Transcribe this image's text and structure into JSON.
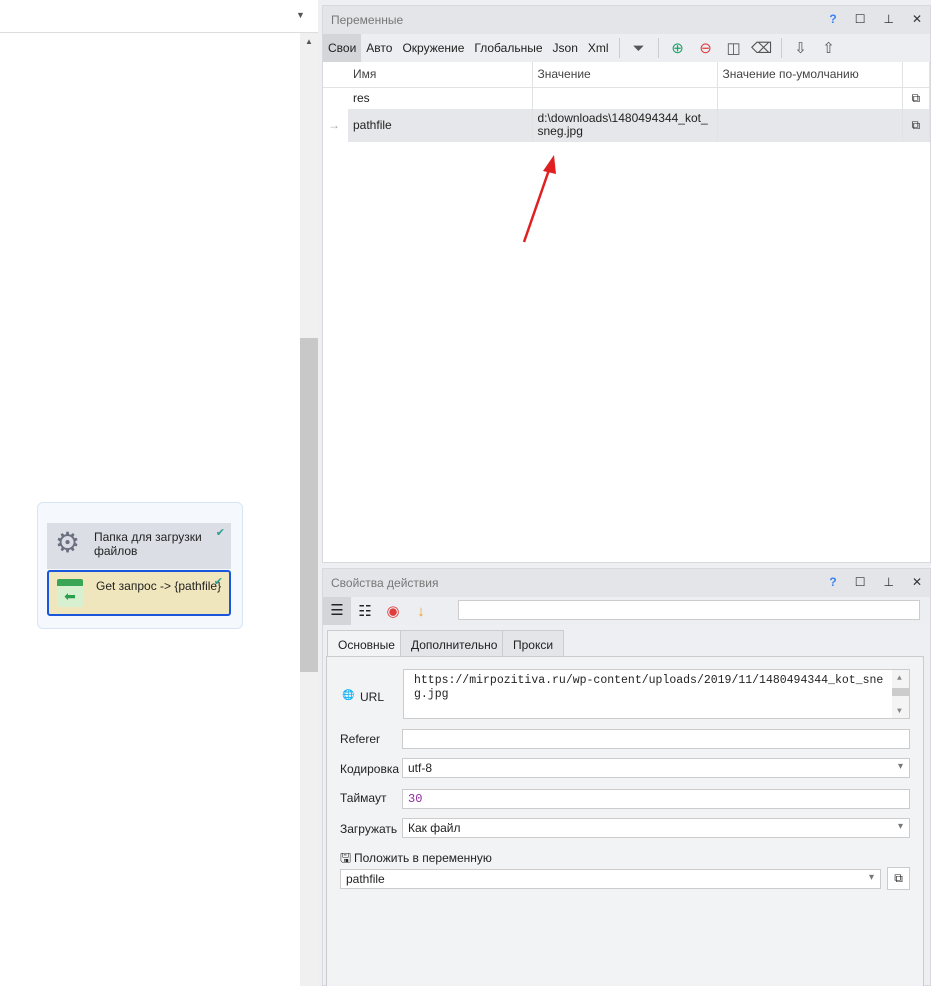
{
  "canvas": {
    "nodes": [
      {
        "label": "Папка для загрузки файлов",
        "icon": "gear-icon"
      },
      {
        "label": "Get запрос -> {pathfile}",
        "icon": "get-request-icon"
      }
    ]
  },
  "variables": {
    "title": "Переменные",
    "window_buttons": [
      "?",
      "☐",
      "⊥",
      "✕"
    ],
    "tabs": [
      "Свои",
      "Авто",
      "Окружение",
      "Глобальные",
      "Json",
      "Xml"
    ],
    "columns": [
      "Имя",
      "Значение",
      "Значение по-умолчанию"
    ],
    "rows": [
      {
        "name": "res",
        "value": "",
        "default": ""
      },
      {
        "name": "pathfile",
        "value": "d:\\downloads\\1480494344_kot_sneg.jpg",
        "default": ""
      }
    ]
  },
  "action": {
    "title": "Свойства действия",
    "tabs": [
      "Основные",
      "Дополнительно",
      "Прокси"
    ],
    "url_label": "URL",
    "url": "https://mirpozitiva.ru/wp-content/uploads/2019/11/1480494344_kot_sneg.jpg",
    "referer_label": "Referer",
    "referer": "",
    "encoding_label": "Кодировка",
    "encoding": "utf-8",
    "timeout_label": "Таймаут",
    "timeout": "30",
    "download_label": "Загружать",
    "download": "Как файл",
    "save_label": "Положить в переменную",
    "save_var": "pathfile"
  },
  "colors": {
    "accent": "#1a56db",
    "annotation": "#e02020"
  }
}
